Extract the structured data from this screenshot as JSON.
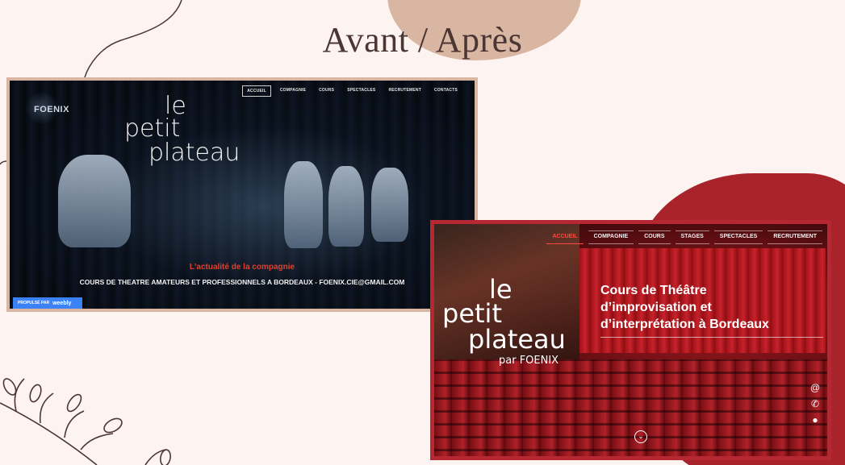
{
  "slide": {
    "title": "Avant / Après"
  },
  "before": {
    "logo": "FOENIX",
    "nav": [
      "ACCUEIL",
      "COMPAGNIE",
      "COURS",
      "SPECTACLES",
      "RECRUTEMENT",
      "CONTACTS"
    ],
    "active_nav": "ACCUEIL",
    "site_title": {
      "line1": "le",
      "line2": "petit",
      "line3": "plateau"
    },
    "news": "L'actualité de la compagnie",
    "subtitle": "COURS DE THEATRE AMATEURS ET PROFESSIONNELS A BORDEAUX - FOENIX.CIE@GMAIL.COM",
    "badge": {
      "prefix": "PROPULSÉ PAR",
      "brand": "weebly"
    }
  },
  "after": {
    "nav": [
      "ACCUEIL",
      "COMPAGNIE",
      "COURS",
      "STAGES",
      "SPECTACLES",
      "RECRUTEMENT"
    ],
    "active_nav": "ACCUEIL",
    "site_title": {
      "line1": "le",
      "line2": "petit",
      "line3": "plateau",
      "line4": "par FOENIX"
    },
    "headline": {
      "line1": "Cours de Théâtre",
      "line2": "d’improvisation et",
      "line3": "d’interprétation à Bordeaux"
    },
    "contact_icons": [
      "email-icon",
      "phone-icon",
      "location-icon"
    ],
    "scroll_icon": "chevron-down-icon"
  },
  "colors": {
    "background": "#fdf3f0",
    "accent_red": "#b62831",
    "frame_beige": "#d9b6a2",
    "nav_active_red": "#ff4a3d"
  }
}
